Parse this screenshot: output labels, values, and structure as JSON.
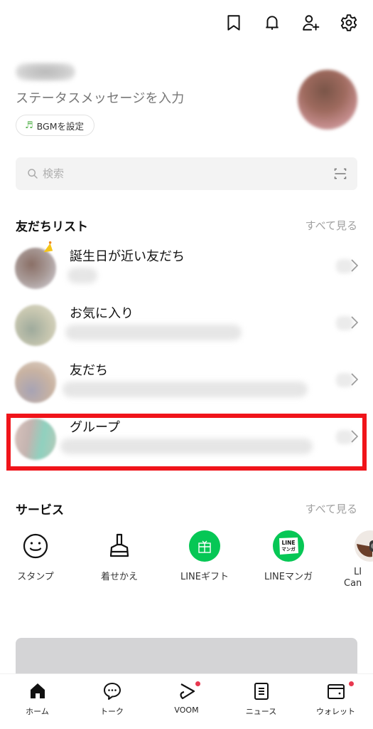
{
  "header": {
    "icons": [
      "bookmark-icon",
      "bell-icon",
      "add-friend-icon",
      "settings-icon"
    ]
  },
  "profile": {
    "status_placeholder": "ステータスメッセージを入力",
    "bgm_button": "BGMを設定"
  },
  "search": {
    "placeholder": "検索"
  },
  "friends_section": {
    "title": "友だちリスト",
    "see_all": "すべて見る",
    "items": [
      {
        "label": "誕生日が近い友だち"
      },
      {
        "label": "お気に入り"
      },
      {
        "label": "友だち"
      },
      {
        "label": "グループ"
      }
    ]
  },
  "services_section": {
    "title": "サービス",
    "see_all": "すべて見る",
    "items": [
      {
        "label": "スタンプ",
        "icon": "smiley-icon"
      },
      {
        "label": "着せかえ",
        "icon": "brush-icon"
      },
      {
        "label": "LINEギフト",
        "icon": "gift-icon"
      },
      {
        "label": "LINEマンガ",
        "icon": "manga-icon"
      },
      {
        "label": "LINE Camera",
        "label_line1": "LI",
        "label_line2": "Can",
        "icon": "camera-icon"
      }
    ],
    "manga_icon_text_1": "LINE",
    "manga_icon_text_2": "マンガ"
  },
  "colors": {
    "line_green": "#06c755",
    "highlight_red": "#f0141a",
    "badge_red": "#e8384f"
  },
  "bottom_nav": {
    "items": [
      {
        "label": "ホーム",
        "active": true
      },
      {
        "label": "トーク"
      },
      {
        "label": "VOOM",
        "badge": true
      },
      {
        "label": "ニュース"
      },
      {
        "label": "ウォレット",
        "badge": true
      }
    ]
  }
}
